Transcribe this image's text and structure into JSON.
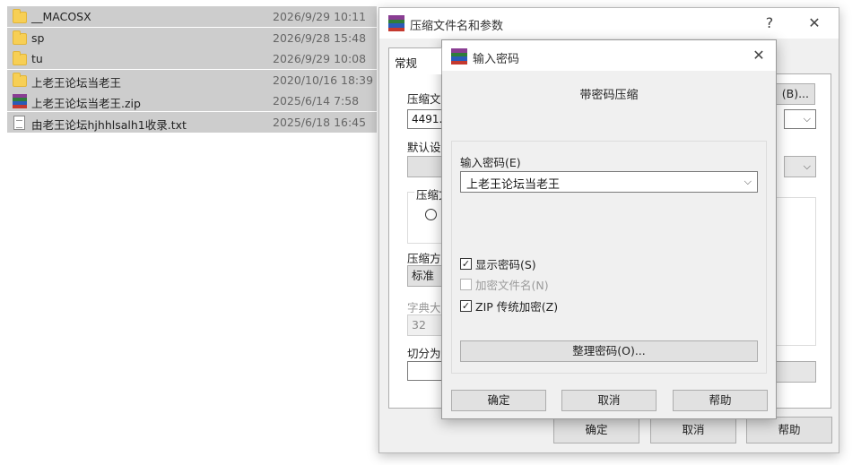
{
  "files": [
    {
      "name": "__MACOSX",
      "date": "2026/9/29 10:11",
      "icon": "folder-icon"
    },
    {
      "name": "sp",
      "date": "2026/9/28 15:48",
      "icon": "folder-icon"
    },
    {
      "name": "tu",
      "date": "2026/9/29 10:08",
      "icon": "folder-icon"
    },
    {
      "name": "上老王论坛当老王",
      "date": "2020/10/16 18:39",
      "icon": "folder-icon"
    },
    {
      "name": "上老王论坛当老王.zip",
      "date": "2025/6/14 7:58",
      "icon": "winrar-archive-icon"
    },
    {
      "name": "由老王论坛hjhhlsalh1收录.txt",
      "date": "2025/6/18 16:45",
      "icon": "text-file-icon"
    }
  ],
  "back_dialog": {
    "title": "压缩文件名和参数",
    "help_glyph": "?",
    "close_glyph": "✕",
    "tab_general": "常规",
    "archive_name_label": "压缩文",
    "archive_name_value": "4491.z",
    "browse_label": "(B)...",
    "default_profile_label": "默认设",
    "format_group_label": "压缩文",
    "method_label": "压缩方",
    "method_value": "标准",
    "dict_label": "字典大",
    "dict_value": "32",
    "split_label": "切分为",
    "ok": "确定",
    "cancel": "取消",
    "help": "帮助"
  },
  "front_dialog": {
    "title": "输入密码",
    "close_glyph": "✕",
    "heading": "带密码压缩",
    "password_label": "输入密码(E)",
    "password_value": "上老王论坛当老王",
    "show_password": "显示密码(S)",
    "show_password_checked": true,
    "encrypt_names": "加密文件名(N)",
    "encrypt_names_checked": false,
    "zip_legacy": "ZIP 传统加密(Z)",
    "zip_legacy_checked": true,
    "check_glyph": "✓",
    "organize": "整理密码(O)...",
    "ok": "确定",
    "cancel": "取消",
    "help": "帮助"
  }
}
